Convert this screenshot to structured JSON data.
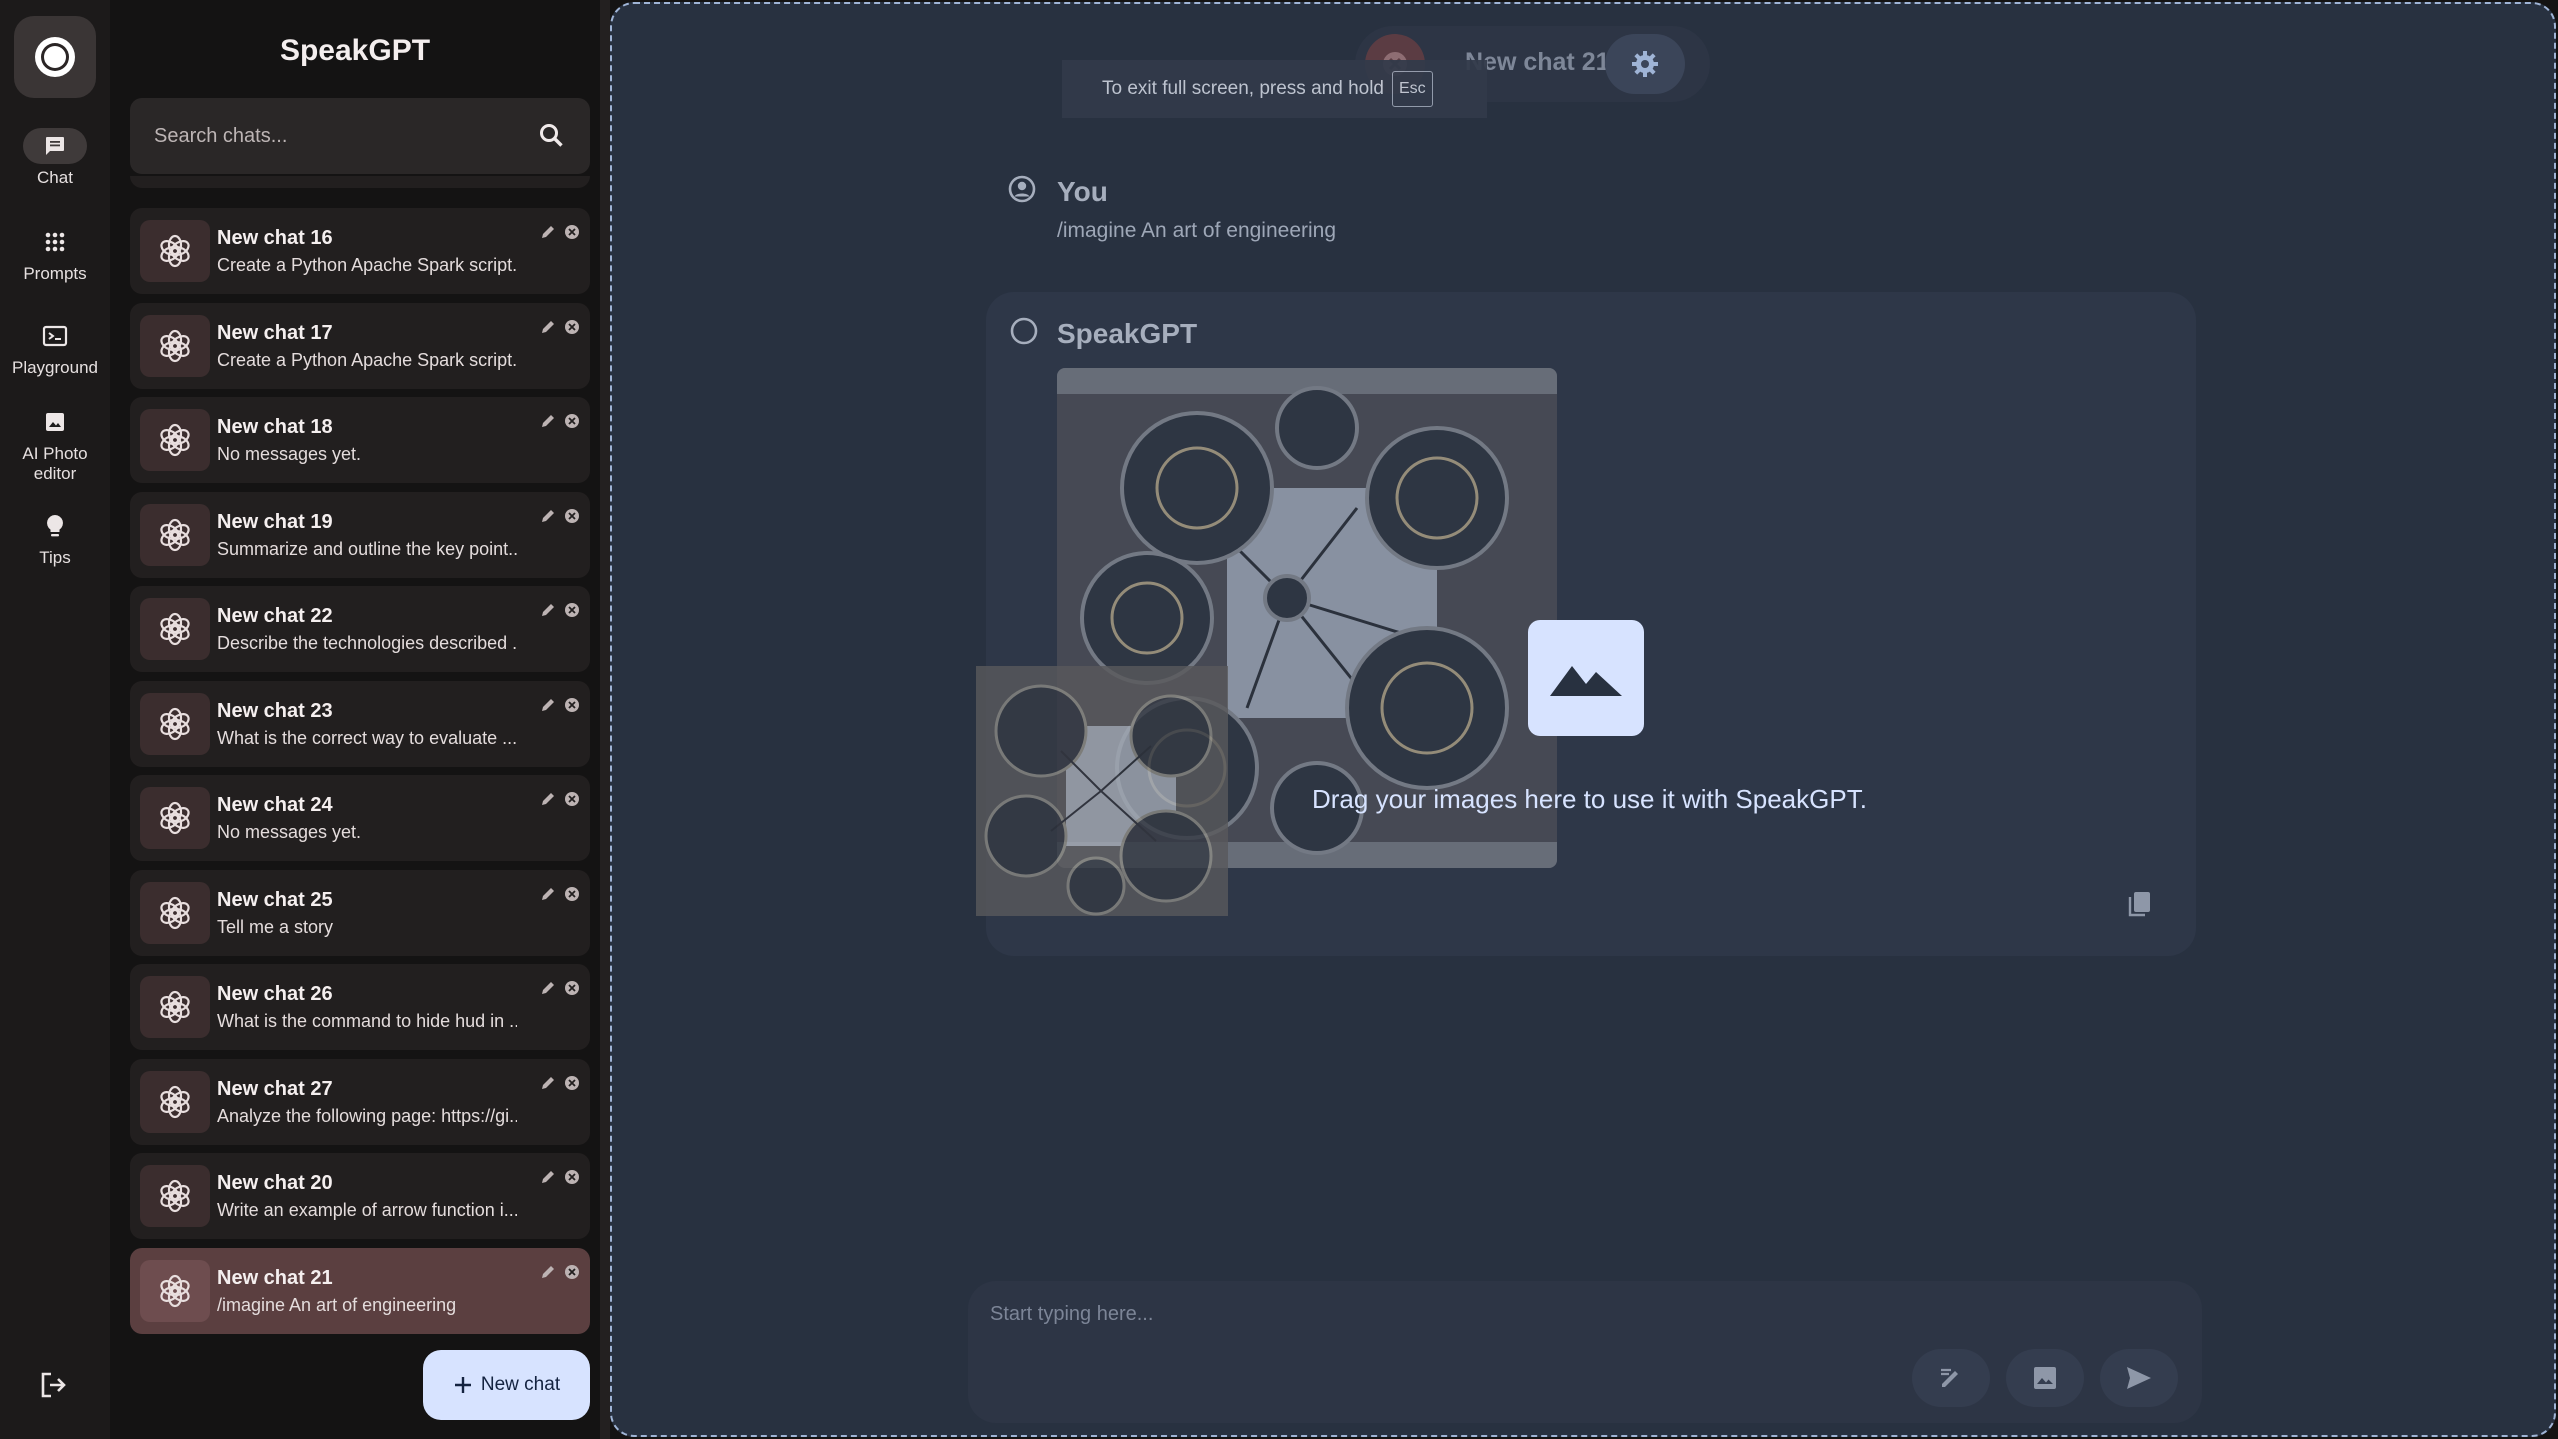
{
  "app": {
    "title": "SpeakGPT"
  },
  "rail": {
    "items": [
      {
        "label": "Chat",
        "icon": "chat-icon",
        "active": true
      },
      {
        "label": "Prompts",
        "icon": "apps-grid-icon",
        "active": false
      },
      {
        "label": "Playground",
        "icon": "terminal-icon",
        "active": false
      },
      {
        "label": "AI Photo editor",
        "icon": "image-icon",
        "active": false
      },
      {
        "label": "Tips",
        "icon": "lightbulb-icon",
        "active": false
      }
    ]
  },
  "search": {
    "placeholder": "Search chats..."
  },
  "chats": [
    {
      "title": "New chat 16",
      "subtitle": "Create a Python Apache Spark script..."
    },
    {
      "title": "New chat 17",
      "subtitle": "Create a Python Apache Spark script..."
    },
    {
      "title": "New chat 18",
      "subtitle": "No messages yet."
    },
    {
      "title": "New chat 19",
      "subtitle": "Summarize and outline the key point..."
    },
    {
      "title": "New chat 22",
      "subtitle": "Describe the technologies described ..."
    },
    {
      "title": "New chat 23",
      "subtitle": "What is the correct way to evaluate ..."
    },
    {
      "title": "New chat 24",
      "subtitle": "No messages yet."
    },
    {
      "title": "New chat 25",
      "subtitle": "Tell me a story"
    },
    {
      "title": "New chat 26",
      "subtitle": "What is the command to hide hud in ..."
    },
    {
      "title": "New chat 27",
      "subtitle": "Analyze the following page: https://gi..."
    },
    {
      "title": "New chat 20",
      "subtitle": "Write an example of arrow function i..."
    },
    {
      "title": "New chat 21",
      "subtitle": "/imagine An art of engineering",
      "active": true
    }
  ],
  "new_chat_label": "New chat",
  "header": {
    "title": "New chat 21"
  },
  "fullscreen_toast": {
    "text": "To exit full screen, press and hold",
    "key": "Esc"
  },
  "messages": {
    "user": {
      "name": "You",
      "text": "/imagine An art of engineering"
    },
    "bot": {
      "name": "SpeakGPT"
    }
  },
  "drop_overlay": {
    "text": "Drag your images here to use it with SpeakGPT."
  },
  "composer": {
    "placeholder": "Start typing here..."
  },
  "colors": {
    "accent": "#d7e3ff",
    "main_bg": "#283140",
    "panel_bg": "#141313",
    "active_chat": "#5b3f40"
  }
}
